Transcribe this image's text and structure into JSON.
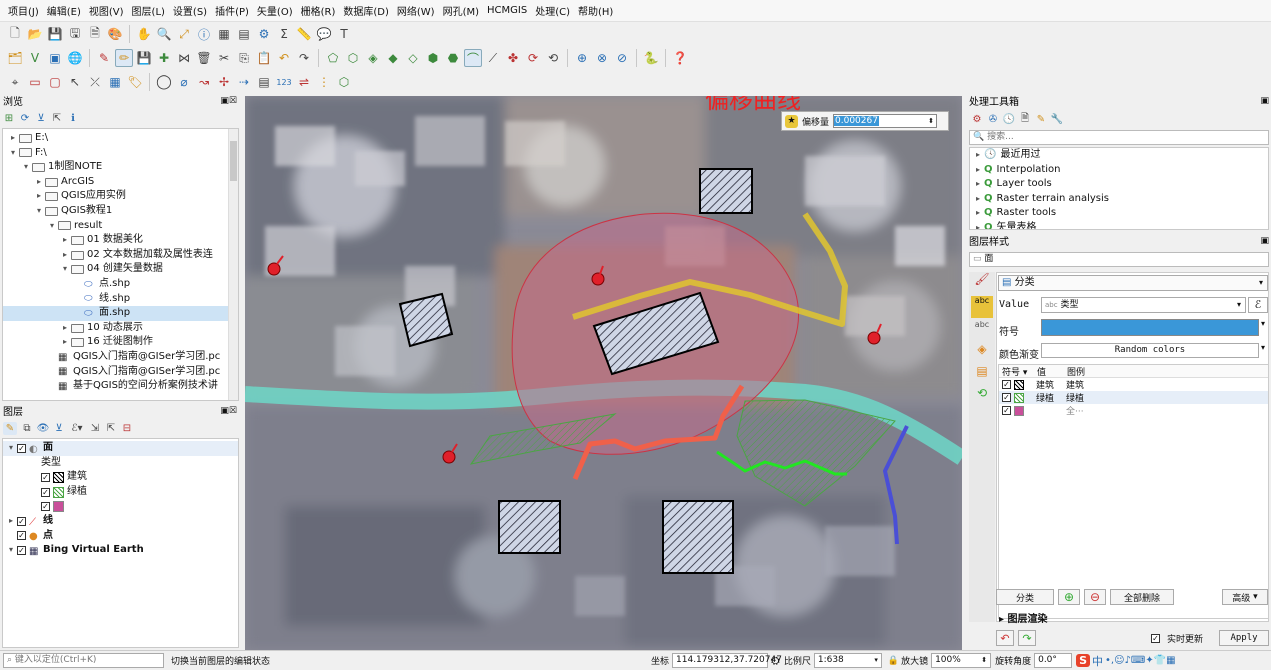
{
  "menu": [
    "项目(J)",
    "编辑(E)",
    "视图(V)",
    "图层(L)",
    "设置(S)",
    "插件(P)",
    "矢量(O)",
    "栅格(R)",
    "数据库(D)",
    "网络(W)",
    "网孔(M)",
    "HCMGIS",
    "处理(C)",
    "帮助(H)"
  ],
  "browser": {
    "title": "浏览",
    "items": [
      {
        "label": "E:\\",
        "level": 0,
        "arrow": "▸",
        "type": "folder"
      },
      {
        "label": "F:\\",
        "level": 0,
        "arrow": "▾",
        "type": "folder"
      },
      {
        "label": "1制图NOTE",
        "level": 1,
        "arrow": "▾",
        "type": "folder"
      },
      {
        "label": "ArcGIS",
        "level": 2,
        "arrow": "▸",
        "type": "folder"
      },
      {
        "label": "QGIS应用实例",
        "level": 2,
        "arrow": "▸",
        "type": "folder"
      },
      {
        "label": "QGIS教程1",
        "level": 2,
        "arrow": "▾",
        "type": "folder"
      },
      {
        "label": "result",
        "level": 3,
        "arrow": "▾",
        "type": "folder"
      },
      {
        "label": "01 数据美化",
        "level": 4,
        "arrow": "▸",
        "type": "folder"
      },
      {
        "label": "02 文本数据加载及属性表连",
        "level": 4,
        "arrow": "▸",
        "type": "folder"
      },
      {
        "label": "04 创建矢量数据",
        "level": 4,
        "arrow": "▾",
        "type": "folder"
      },
      {
        "label": "点.shp",
        "level": 5,
        "arrow": "",
        "type": "file"
      },
      {
        "label": "线.shp",
        "level": 5,
        "arrow": "",
        "type": "file"
      },
      {
        "label": "面.shp",
        "level": 5,
        "arrow": "",
        "type": "file",
        "selected": true
      },
      {
        "label": "10 动态展示",
        "level": 4,
        "arrow": "▸",
        "type": "folder"
      },
      {
        "label": "16 迁徙图制作",
        "level": 4,
        "arrow": "▸",
        "type": "folder"
      },
      {
        "label": "QGIS入门指南@GISer学习团.pc",
        "level": 3,
        "arrow": "",
        "type": "doc"
      },
      {
        "label": "QGIS入门指南@GISer学习团.pc",
        "level": 3,
        "arrow": "",
        "type": "doc"
      },
      {
        "label": "基于QGIS的空间分析案例技术讲",
        "level": 3,
        "arrow": "",
        "type": "doc"
      }
    ]
  },
  "layers": {
    "title": "图层",
    "items": [
      {
        "label": "面",
        "bold": true,
        "level": 0,
        "arrow": "▾",
        "check": true,
        "icon": "polygon-layer-icon"
      },
      {
        "label": "类型",
        "bold": false,
        "level": 1,
        "arrow": "",
        "check": null,
        "icon": ""
      },
      {
        "label": "建筑",
        "bold": false,
        "level": 1,
        "arrow": "",
        "check": true,
        "icon": "swatch-hatch"
      },
      {
        "label": "绿植",
        "bold": false,
        "level": 1,
        "arrow": "",
        "check": true,
        "icon": "swatch-green"
      },
      {
        "label": "",
        "bold": false,
        "level": 1,
        "arrow": "",
        "check": true,
        "icon": "swatch-pink"
      },
      {
        "label": "线",
        "bold": true,
        "level": 0,
        "arrow": "▸",
        "check": true,
        "icon": "line-layer-icon"
      },
      {
        "label": "点",
        "bold": true,
        "level": 0,
        "arrow": "",
        "check": true,
        "icon": "point-layer-icon"
      },
      {
        "label": "Bing Virtual Earth",
        "bold": true,
        "level": 0,
        "arrow": "▾",
        "check": true,
        "icon": "raster-layer-icon"
      }
    ]
  },
  "map": {
    "overlay_title": "偏移曲线",
    "offset_label": "偏移量",
    "offset_value": "0.000267"
  },
  "processing": {
    "title": "处理工具箱",
    "search_placeholder": "搜索...",
    "items": [
      "最近用过",
      "Interpolation",
      "Layer tools",
      "Raster terrain analysis",
      "Raster tools",
      "矢量表格"
    ]
  },
  "style": {
    "title": "图层样式",
    "layer_select": "面",
    "renderer": "分类",
    "value_label": "Value",
    "value_field": "类型",
    "symbol_label": "符号",
    "ramp_label": "颜色渐变",
    "ramp_value": "Random colors",
    "col_symbol": "符号",
    "col_value": "值",
    "col_legend": "图例",
    "rows": [
      {
        "value": "建筑",
        "legend": "建筑",
        "swatch": "hatch"
      },
      {
        "value": "绿植",
        "legend": "绿植",
        "swatch": "green"
      },
      {
        "value": "",
        "legend": "全···",
        "swatch": "pink"
      }
    ],
    "classify_btn": "分类",
    "delete_all_btn": "全部删除",
    "advanced_btn": "高级",
    "layer_render": "图层渲染",
    "live_update": "实时更新",
    "apply_btn": "Apply"
  },
  "statusbar": {
    "locate_placeholder": "键入以定位(Ctrl+K)",
    "message": "切换当前图层的编辑状态",
    "coord_label": "坐标",
    "coord_value": "114.179312,37.720747",
    "scale_label": "比例尺",
    "scale_value": "1:638",
    "magnifier_label": "放大镜",
    "magnifier_value": "100%",
    "rotation_label": "旋转角度",
    "rotation_value": "0.0°",
    "ime_label": "中"
  },
  "colors": {
    "accent_blue": "#3a97d8",
    "river": "#6fd3c4",
    "yellow_line": "#e1c52f",
    "red_line": "#f0604a",
    "green_line": "#22e622",
    "blue_line": "#4a4fd6",
    "buffer_fill": "#c26b8a",
    "title_red": "#ee2222"
  }
}
